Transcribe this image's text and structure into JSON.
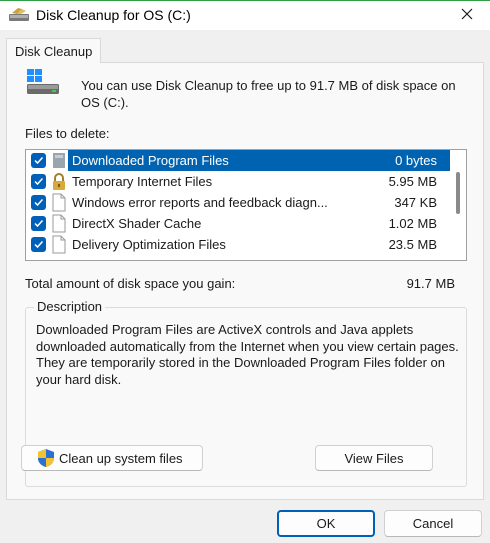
{
  "window": {
    "title": "Disk Cleanup for OS (C:)",
    "icons": {
      "app": "disk-cleanup-icon",
      "close": "close-icon"
    }
  },
  "tabs": [
    {
      "label": "Disk Cleanup",
      "active": true
    }
  ],
  "intro_text": "You can use Disk Cleanup to free up to 91.7 MB of disk space on OS (C:).",
  "files_label": "Files to delete:",
  "files": [
    {
      "name": "Downloaded Program Files",
      "size": "0 bytes",
      "checked": true,
      "selected": true,
      "icon": "program-files-icon"
    },
    {
      "name": "Temporary Internet Files",
      "size": "5.95 MB",
      "checked": true,
      "selected": false,
      "icon": "lock-icon"
    },
    {
      "name": "Windows error reports and feedback diagn...",
      "size": "347 KB",
      "checked": true,
      "selected": false,
      "icon": "file-icon"
    },
    {
      "name": "DirectX Shader Cache",
      "size": "1.02 MB",
      "checked": true,
      "selected": false,
      "icon": "file-icon"
    },
    {
      "name": "Delivery Optimization Files",
      "size": "23.5 MB",
      "checked": true,
      "selected": false,
      "icon": "file-icon"
    }
  ],
  "total": {
    "label": "Total amount of disk space you gain:",
    "value": "91.7 MB"
  },
  "description": {
    "legend": "Description",
    "text": "Downloaded Program Files are ActiveX controls and Java applets downloaded automatically from the Internet when you view certain pages. They are temporarily stored in the Downloaded Program Files folder on your hard disk."
  },
  "buttons": {
    "cleanup_system": "Clean up system files",
    "view_files": "View Files",
    "ok": "OK",
    "cancel": "Cancel"
  },
  "colors": {
    "accent": "#005fb8",
    "selection": "#0063b1",
    "titlebar_border": "#2f9e44"
  }
}
